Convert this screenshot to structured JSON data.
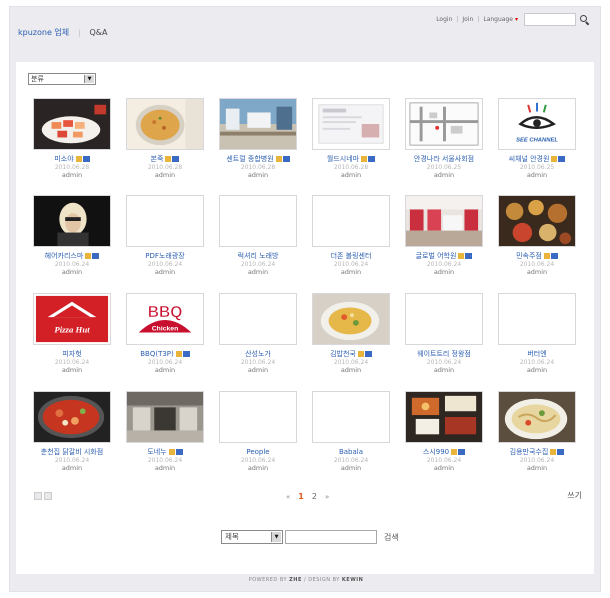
{
  "util": {
    "login": "Login",
    "join": "Join",
    "language": "Language"
  },
  "brand": {
    "site": "kpuzone 업체",
    "section": "Q&A"
  },
  "category": {
    "selected": "분류"
  },
  "items": [
    {
      "title": "미소야",
      "date": "2010.06.28",
      "author": "admin",
      "thumb": "sushi"
    },
    {
      "title": "본죽",
      "date": "2010.06.28",
      "author": "admin",
      "thumb": "porridge"
    },
    {
      "title": "센트럴 종합병원",
      "date": "2010.06.28",
      "author": "admin",
      "thumb": "hospital"
    },
    {
      "title": "월드시네마",
      "date": "2010.06.28",
      "author": "admin",
      "thumb": "cinema"
    },
    {
      "title": "안경나라 서울사회점",
      "date": "2010.06.25",
      "author": "admin",
      "thumb": "map"
    },
    {
      "title": "씨채널 안경원",
      "date": "2010.06.25",
      "author": "admin",
      "thumb": "seechannel"
    },
    {
      "title": "헤어카리스마",
      "date": "2010.06.24",
      "author": "admin",
      "thumb": "hair"
    },
    {
      "title": "PDF노래광장",
      "date": "2010.06.24",
      "author": "admin",
      "thumb": "blank"
    },
    {
      "title": "럭셔리 노래방",
      "date": "2010.06.24",
      "author": "admin",
      "thumb": "blank"
    },
    {
      "title": "더존 볼링센터",
      "date": "2010.06.24",
      "author": "admin",
      "thumb": "blank"
    },
    {
      "title": "글로벌 어학원",
      "date": "2010.06.24",
      "author": "admin",
      "thumb": "academy"
    },
    {
      "title": "민속주점",
      "date": "2010.06.24",
      "author": "admin",
      "thumb": "bowls"
    },
    {
      "title": "피자헛",
      "date": "2010.06.24",
      "author": "admin",
      "thumb": "pizzahut"
    },
    {
      "title": "BBQ(T3P)",
      "date": "2010.06.24",
      "author": "admin",
      "thumb": "bbq"
    },
    {
      "title": "산성노가",
      "date": "2010.06.24",
      "author": "admin",
      "thumb": "blank"
    },
    {
      "title": "김밥천국",
      "date": "2010.06.24",
      "author": "admin",
      "thumb": "rice"
    },
    {
      "title": "웨이트트리 정왕점",
      "date": "2010.06.24",
      "author": "admin",
      "thumb": "blank"
    },
    {
      "title": "버터엔",
      "date": "2010.06.24",
      "author": "admin",
      "thumb": "blank"
    },
    {
      "title": "춘천집 닭갈비 시화점",
      "date": "2010.06.24",
      "author": "admin",
      "thumb": "dakgalbi"
    },
    {
      "title": "도네누",
      "date": "2010.06.24",
      "author": "admin",
      "thumb": "shopfront"
    },
    {
      "title": "People",
      "date": "2010.06.24",
      "author": "admin",
      "thumb": "blank"
    },
    {
      "title": "Babala",
      "date": "2010.06.24",
      "author": "admin",
      "thumb": "blank"
    },
    {
      "title": "스시990",
      "date": "2010.06.24",
      "author": "admin",
      "thumb": "sushiset"
    },
    {
      "title": "김용만국수집",
      "date": "2010.06.24",
      "author": "admin",
      "thumb": "noodle"
    }
  ],
  "flags": [
    true,
    true,
    true,
    true,
    false,
    true,
    true,
    false,
    false,
    false,
    true,
    true,
    false,
    true,
    false,
    true,
    false,
    false,
    false,
    true,
    false,
    false,
    true,
    true
  ],
  "pager": {
    "prev": "«",
    "current": "1",
    "page2": "2",
    "next": "»"
  },
  "write_label": "쓰기",
  "search": {
    "field": "제목",
    "button": "검색"
  },
  "footer": {
    "powered": "POWERED BY",
    "engine": "ZHE",
    "design": "/ DESIGN BY",
    "designer": "KEWIN"
  },
  "colors": {
    "link": "#2b5fb0",
    "accent": "#e05a1a",
    "background": "#ecebf0"
  }
}
